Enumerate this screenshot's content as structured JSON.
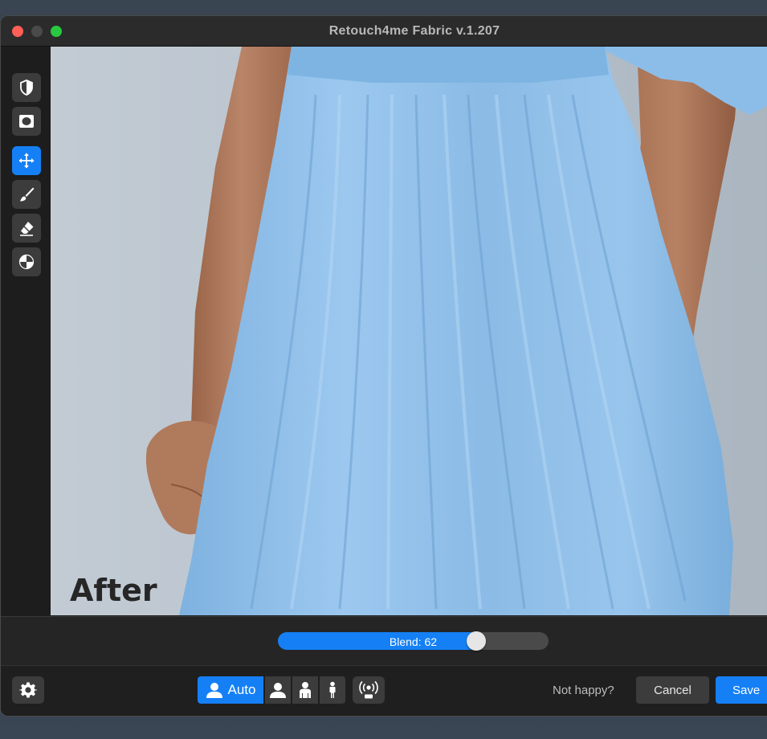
{
  "window": {
    "title": "Retouch4me Fabric v.1.207"
  },
  "toolbar": {
    "tools": [
      {
        "name": "before-after-toggle",
        "icon": "half-shield-icon",
        "active": false
      },
      {
        "name": "mask-view",
        "icon": "mask-icon",
        "active": false
      },
      {
        "name": "move",
        "icon": "move-arrows-icon",
        "active": true
      },
      {
        "name": "brush",
        "icon": "brush-icon",
        "active": false
      },
      {
        "name": "eraser",
        "icon": "eraser-icon",
        "active": false
      },
      {
        "name": "color-picker",
        "icon": "color-wheel-icon",
        "active": false
      }
    ]
  },
  "canvas": {
    "view_label": "After"
  },
  "blend": {
    "label": "Blend: 62",
    "value": 62,
    "max": 100
  },
  "bottom": {
    "mode_auto_label": "Auto",
    "not_happy_text": "Not happy?",
    "cancel_label": "Cancel",
    "save_label": "Save"
  },
  "colors": {
    "accent": "#1580f5",
    "dress": "#8fbde6",
    "skin": "#b07a5c"
  }
}
